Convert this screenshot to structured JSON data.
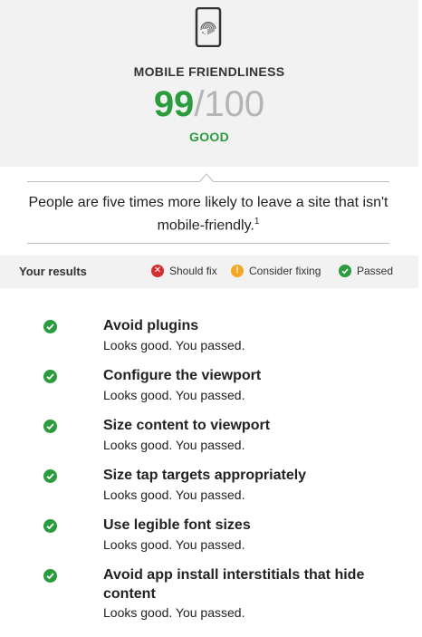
{
  "header": {
    "icon": "mobile-fingerprint-icon",
    "title": "MOBILE FRIENDLINESS",
    "score": "99",
    "score_total": "/100",
    "rating": "GOOD"
  },
  "message": {
    "text": "People are five times more likely to leave a site that isn't mobile-friendly.",
    "footnote": "1"
  },
  "results": {
    "title": "Your results",
    "legend": [
      {
        "label": "Should fix",
        "icon": "x-icon",
        "color": "#d32f2f"
      },
      {
        "label": "Consider fixing",
        "icon": "exclamation-icon",
        "color": "#f5a623"
      },
      {
        "label": "Passed",
        "icon": "check-icon",
        "color": "#2b9c3e"
      }
    ],
    "items": [
      {
        "name": "Avoid plugins",
        "status": "Looks good. You passed."
      },
      {
        "name": "Configure the viewport",
        "status": "Looks good. You passed."
      },
      {
        "name": "Size content to viewport",
        "status": "Looks good. You passed."
      },
      {
        "name": "Size tap targets appropriately",
        "status": "Looks good. You passed."
      },
      {
        "name": "Use legible font sizes",
        "status": "Looks good. You passed."
      },
      {
        "name": "Avoid app install interstitials that hide content",
        "status": "Looks good. You passed."
      }
    ]
  },
  "colors": {
    "good": "#2b9c3e",
    "header_bg": "#f2f2f2",
    "score_total": "#b5b5b5"
  }
}
